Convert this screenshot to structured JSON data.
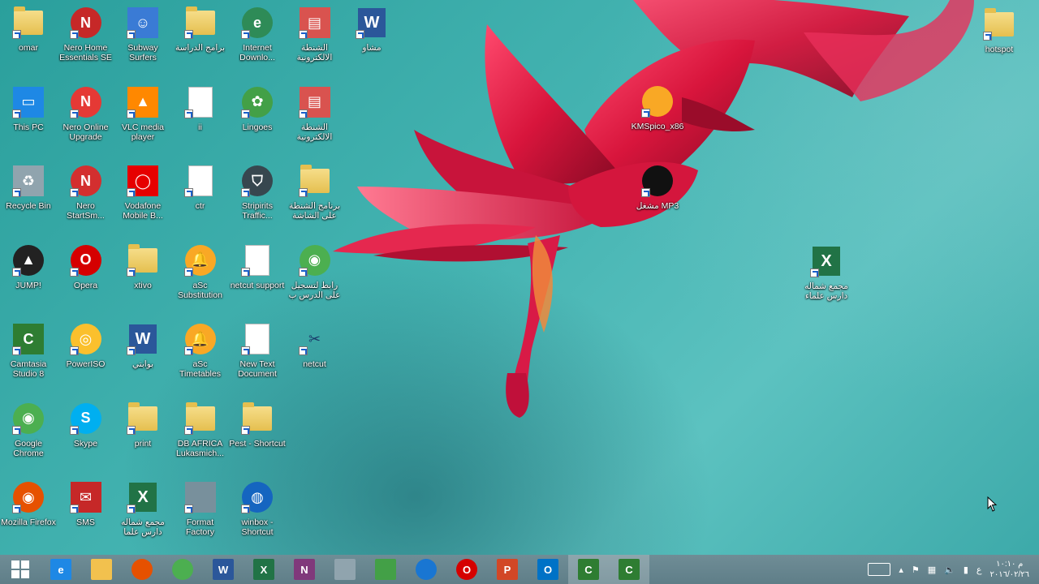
{
  "desktop": {
    "icons": [
      {
        "label": "omar"
      },
      {
        "label": "Nero Home Essentials SE"
      },
      {
        "label": "Subway Surfers"
      },
      {
        "label": "برامج الدراسة"
      },
      {
        "label": "Internet Downlo..."
      },
      {
        "label": "الشنطة الالكترونية"
      },
      {
        "label": "مشاو"
      },
      {
        "label": "This PC"
      },
      {
        "label": "Nero Online Upgrade"
      },
      {
        "label": "VLC media player"
      },
      {
        "label": "ii"
      },
      {
        "label": "Lingoes"
      },
      {
        "label": "الشنطة الالكترونية"
      },
      {
        "label": "Recycle Bin"
      },
      {
        "label": "Nero StartSm..."
      },
      {
        "label": "Vodafone Mobile B..."
      },
      {
        "label": "ctr"
      },
      {
        "label": "Stripirits Traffic..."
      },
      {
        "label": "برنامج الشنطة على الشاشة"
      },
      {
        "label": "JUMP!"
      },
      {
        "label": "Opera"
      },
      {
        "label": "xtivo"
      },
      {
        "label": "aSc Substitution"
      },
      {
        "label": "netcut support"
      },
      {
        "label": "رابط لتسجيل على الدرس ب"
      },
      {
        "label": "Camtasia Studio 8"
      },
      {
        "label": "PowerISO"
      },
      {
        "label": "بوابتي"
      },
      {
        "label": "aSc Timetables"
      },
      {
        "label": "New Text Document"
      },
      {
        "label": "netcut"
      },
      {
        "label": "Google Chrome"
      },
      {
        "label": "Skype"
      },
      {
        "label": "print"
      },
      {
        "label": "DB AFRICA Lukasmich..."
      },
      {
        "label": "Pest - Shortcut"
      },
      {
        "label": "Mozilla Firefox"
      },
      {
        "label": "SMS"
      },
      {
        "label": "مجمع شماله دارس علما"
      },
      {
        "label": "Format Factory"
      },
      {
        "label": "winbox - Shortcut"
      },
      {
        "label": "KMSpico_x86"
      },
      {
        "label": "مشغل MP3"
      },
      {
        "label": "مجمع شماله دارس علماء"
      },
      {
        "label": "hotspot"
      }
    ]
  },
  "taskbar": {
    "start_label": "Start",
    "apps": [
      {
        "name": "Internet Explorer",
        "glyph": "e"
      },
      {
        "name": "File Explorer",
        "glyph": ""
      },
      {
        "name": "Firefox",
        "glyph": ""
      },
      {
        "name": "Chrome",
        "glyph": ""
      },
      {
        "name": "Word",
        "glyph": "W"
      },
      {
        "name": "Excel",
        "glyph": "X"
      },
      {
        "name": "OneNote",
        "glyph": "N"
      },
      {
        "name": "Paint",
        "glyph": ""
      },
      {
        "name": "Store",
        "glyph": ""
      },
      {
        "name": "Browser",
        "glyph": ""
      },
      {
        "name": "Opera",
        "glyph": "O"
      },
      {
        "name": "PowerPoint",
        "glyph": "P"
      },
      {
        "name": "Outlook",
        "glyph": "O"
      },
      {
        "name": "Camtasia",
        "glyph": "C"
      },
      {
        "name": "Camtasia Recorder",
        "glyph": "C"
      }
    ],
    "tray": {
      "clock_time": "م ١٠:١٠",
      "clock_date": "٢٠١٦/٠٢/٢٦"
    }
  }
}
